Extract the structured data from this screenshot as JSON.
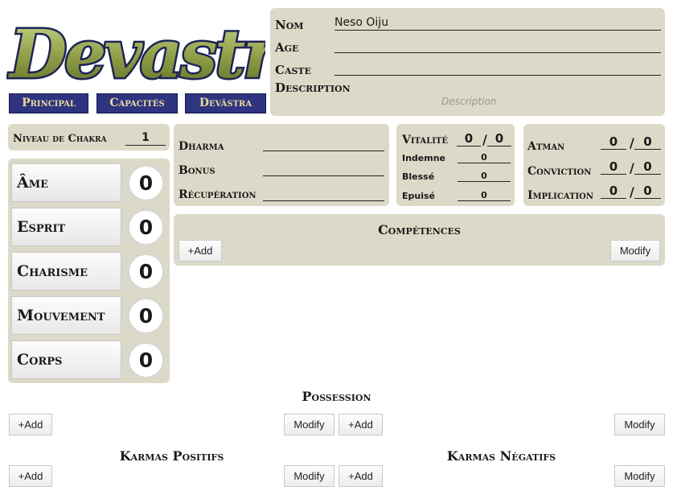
{
  "logo": {
    "text": "Devastra"
  },
  "nav": {
    "principal": "Principal",
    "capacites": "Capacités",
    "devastra": "Devâstra"
  },
  "identity": {
    "nom_label": "Nom",
    "nom_value": "Neso Oiju",
    "age_label": "Age",
    "age_value": "",
    "caste_label": "Caste",
    "caste_value": "",
    "description_label": "Description",
    "description_placeholder": "Description"
  },
  "chakra": {
    "label": "Niveau de Chakra",
    "value": "1"
  },
  "attributes": [
    {
      "label": "Âme",
      "value": "0"
    },
    {
      "label": "Esprit",
      "value": "0"
    },
    {
      "label": "Charisme",
      "value": "0"
    },
    {
      "label": "Mouvement",
      "value": "0"
    },
    {
      "label": "Corps",
      "value": "0"
    }
  ],
  "dharma": {
    "dharma_label": "Dharma",
    "bonus_label": "Bonus",
    "recuperation_label": "Récupération"
  },
  "vitalite": {
    "label": "Vitalité",
    "current": "0",
    "max": "0",
    "indemne_label": "Indemne",
    "indemne_value": "0",
    "blesse_label": "Blessé",
    "blesse_value": "0",
    "epuise_label": "Epuisé",
    "epuise_value": "0"
  },
  "atman": {
    "atman_label": "Atman",
    "atman_current": "0",
    "atman_max": "0",
    "conviction_label": "Conviction",
    "conviction_current": "0",
    "conviction_max": "0",
    "implication_label": "Implication",
    "implication_current": "0",
    "implication_max": "0"
  },
  "competences": {
    "title": "Compétences",
    "add": "+Add",
    "modify": "Modify"
  },
  "possession": {
    "title": "Possession",
    "add_left": "+Add",
    "modify_left": "Modify",
    "add_right": "+Add",
    "modify_right": "Modify"
  },
  "karmas_positifs": {
    "title": "Karmas Positifs",
    "add": "+Add",
    "modify": "Modify"
  },
  "karmas_negatifs": {
    "title": "Karmas Négatifs",
    "add": "+Add",
    "modify": "Modify"
  },
  "slash": "/"
}
